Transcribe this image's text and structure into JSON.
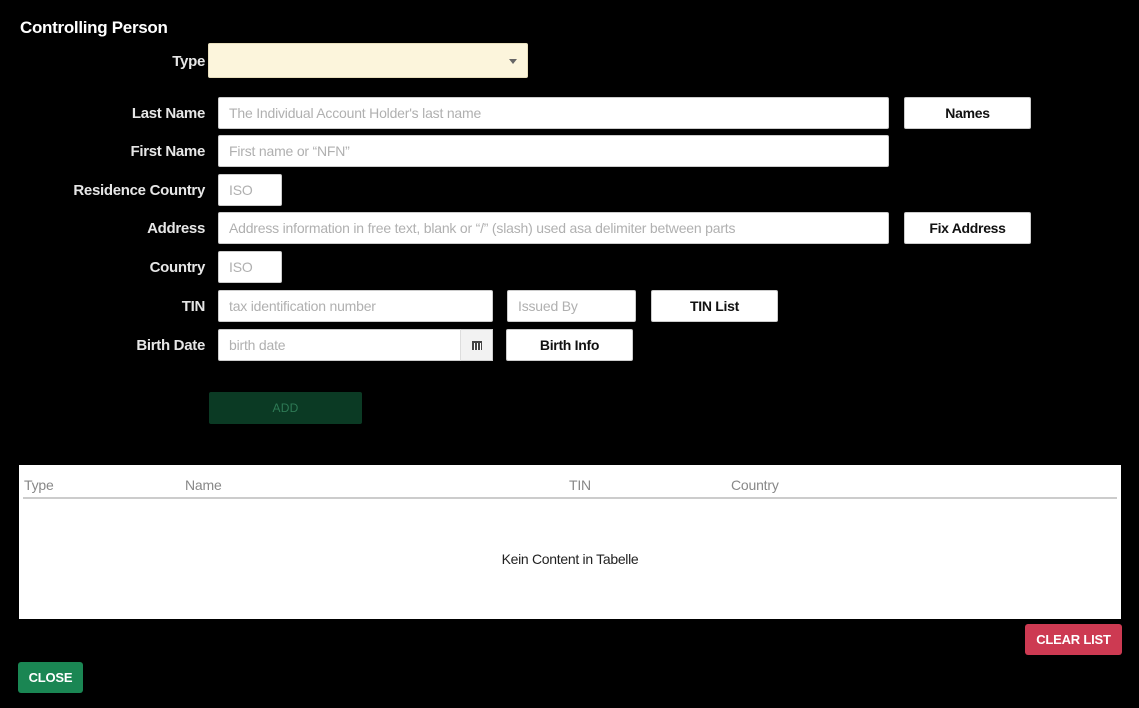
{
  "title": "Controlling Person",
  "form": {
    "type_label": "Type",
    "type_value": "",
    "last_name_label": "Last Name",
    "last_name_placeholder": "The Individual Account Holder's last name",
    "first_name_label": "First Name",
    "first_name_placeholder": "First name or “NFN”",
    "residence_country_label": "Residence Country",
    "residence_country_placeholder": "ISO",
    "address_label": "Address",
    "address_placeholder": "Address information in free text, blank or “/” (slash) used asa delimiter between parts",
    "country_label": "Country",
    "country_placeholder": "ISO",
    "tin_label": "TIN",
    "tin_placeholder": "tax identification number",
    "issued_by_placeholder": "Issued By",
    "birth_date_label": "Birth Date",
    "birth_date_placeholder": "birth date"
  },
  "buttons": {
    "names": "Names",
    "fix_address": "Fix Address",
    "tin_list": "TIN List",
    "birth_info": "Birth Info",
    "add": "ADD",
    "clear_list": "CLEAR LIST",
    "close": "CLOSE"
  },
  "table": {
    "columns": [
      "Type",
      "Name",
      "TIN",
      "Country"
    ],
    "empty_message": "Kein Content in Tabelle"
  },
  "icons": {
    "type_dropdown": "chevron-down-icon",
    "birth_date": "calendar-icon"
  },
  "colors": {
    "background": "#000000",
    "select_bg": "#fcf5dc",
    "add_button": "#0b3a24",
    "clear_button": "#cd3a52",
    "close_button": "#1a8653"
  }
}
